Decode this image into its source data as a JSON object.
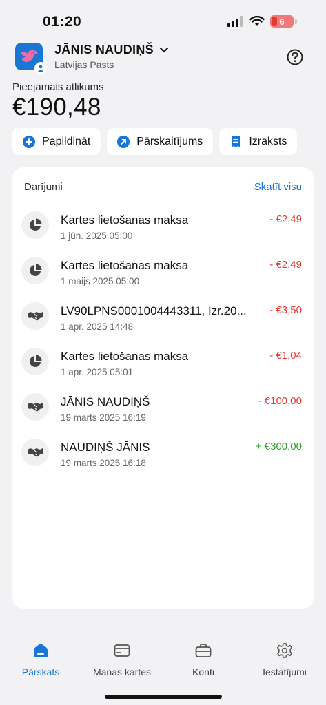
{
  "status": {
    "time": "01:20",
    "battery": "6"
  },
  "account": {
    "name": "JĀNIS NAUDIŅŠ",
    "bank": "Latvijas Pasts"
  },
  "balance": {
    "label": "Pieejamais atlikums",
    "value": "€190,48"
  },
  "actions": [
    {
      "label": "Papildināt",
      "icon": "plus-circle-icon"
    },
    {
      "label": "Pārskaitījums",
      "icon": "arrow-up-right-circle-icon"
    },
    {
      "label": "Izraksts",
      "icon": "statement-icon"
    }
  ],
  "transactions": {
    "title": "Darījumi",
    "see_all": "Skatīt visu",
    "items": [
      {
        "title": "Kartes lietošanas maksa",
        "date": "1 jūn. 2025  05:00",
        "amount": "- €2,49",
        "type": "negative",
        "icon": "pie-chart-icon"
      },
      {
        "title": "Kartes lietošanas maksa",
        "date": "1 maijs 2025  05:00",
        "amount": "- €2,49",
        "type": "negative",
        "icon": "pie-chart-icon"
      },
      {
        "title": "LV90LPNS0001004443311, Izr.20...",
        "date": "1 apr. 2025  14:48",
        "amount": "- €3,50",
        "type": "negative",
        "icon": "handshake-icon"
      },
      {
        "title": "Kartes lietošanas maksa",
        "date": "1 apr. 2025  05:01",
        "amount": "- €1,04",
        "type": "negative",
        "icon": "pie-chart-icon"
      },
      {
        "title": "JĀNIS NAUDIŅŠ",
        "date": "19 marts 2025  16:19",
        "amount": "- €100,00",
        "type": "negative",
        "icon": "handshake-icon"
      },
      {
        "title": "NAUDIŅŠ JĀNIS",
        "date": "19 marts 2025  16:18",
        "amount": "+ €300,00",
        "type": "positive",
        "icon": "handshake-icon"
      }
    ]
  },
  "tabs": [
    {
      "label": "Pārskats",
      "icon": "home-icon",
      "active": true
    },
    {
      "label": "Manas kartes",
      "icon": "card-icon",
      "active": false
    },
    {
      "label": "Konti",
      "icon": "briefcase-icon",
      "active": false
    },
    {
      "label": "Iestatījumi",
      "icon": "gear-icon",
      "active": false
    }
  ],
  "colors": {
    "accent": "#1976d2",
    "negative": "#e53935",
    "positive": "#2ea52e",
    "background": "#f2f2f4"
  }
}
